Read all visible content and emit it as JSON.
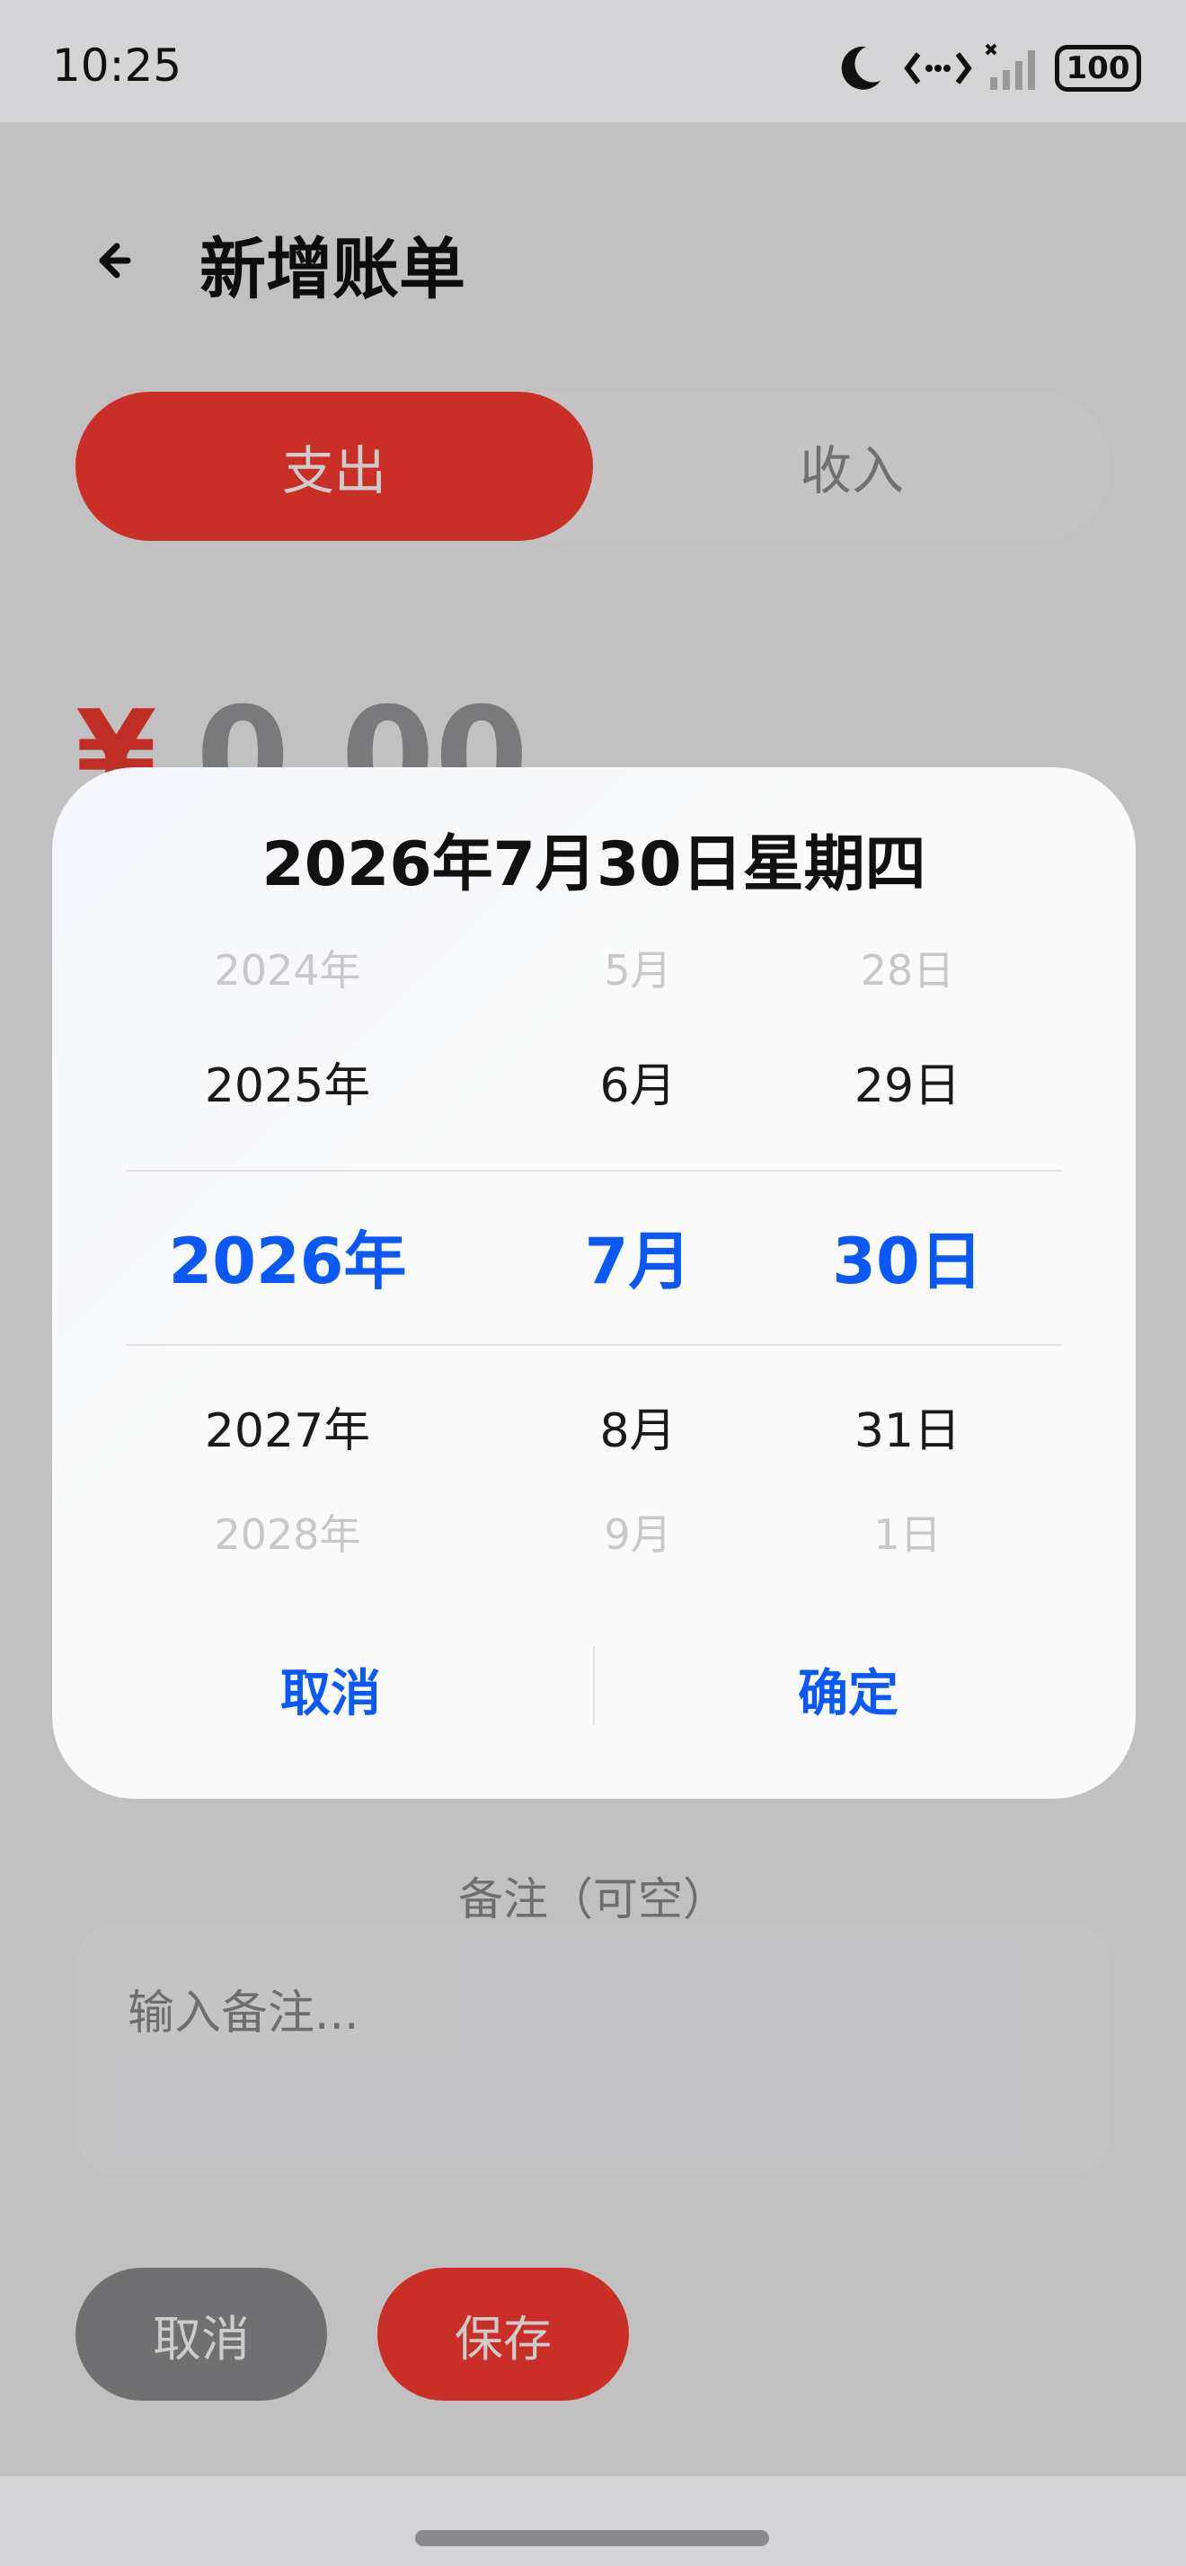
{
  "status_bar": {
    "time": "10:25",
    "battery": "100",
    "icons": [
      "moon-icon",
      "data-transfer-icon",
      "signal-icon",
      "battery-icon"
    ]
  },
  "header": {
    "title": "新增账单",
    "back_icon": "arrow-left-icon"
  },
  "type_toggle": {
    "expense_label": "支出",
    "income_label": "收入",
    "selected": "支出"
  },
  "amount": {
    "currency_symbol": "¥",
    "value": "0.00"
  },
  "note": {
    "label": "备注（可空）",
    "placeholder": "输入备注..."
  },
  "buttons": {
    "cancel_label": "取消",
    "save_label": "保存"
  },
  "date_picker": {
    "title": "2026年7月30日星期四",
    "years": [
      "2024年",
      "2025年",
      "2026年",
      "2027年",
      "2028年"
    ],
    "months": [
      "5月",
      "6月",
      "7月",
      "8月",
      "9月"
    ],
    "days": [
      "28日",
      "29日",
      "30日",
      "31日",
      "1日"
    ],
    "cancel_label": "取消",
    "confirm_label": "确定"
  },
  "colors": {
    "accent_red": "#fd3b31",
    "accent_blue": "#0a59f7"
  }
}
